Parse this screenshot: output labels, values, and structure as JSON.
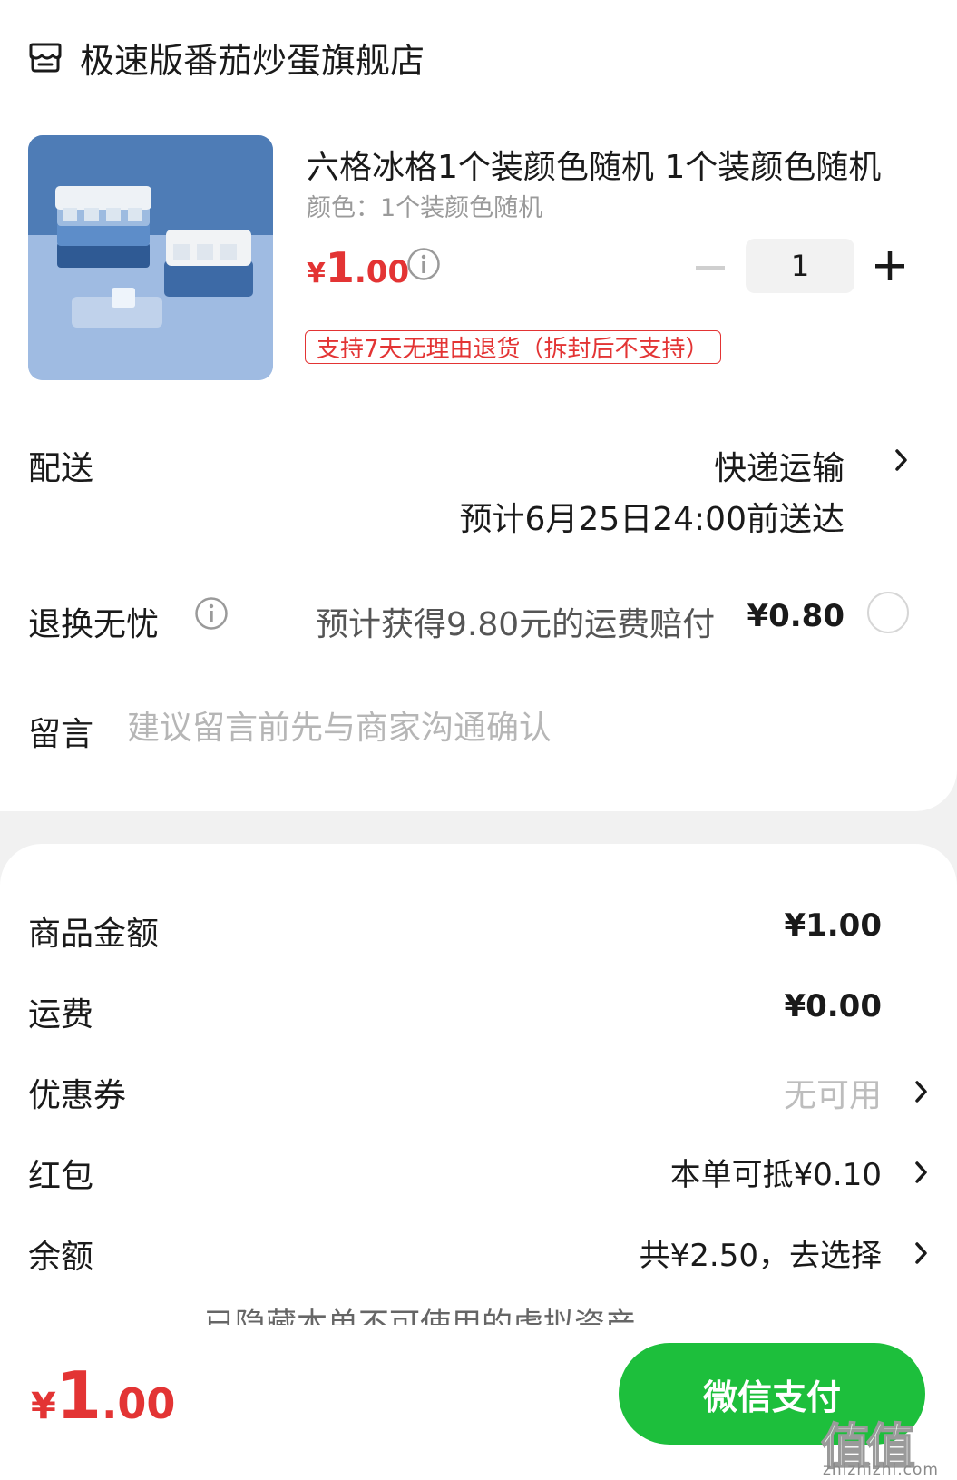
{
  "store": {
    "name": "极速版番茄炒蛋旗舰店",
    "icon": "store-icon"
  },
  "product": {
    "title": "六格冰格1个装颜色随机 1个装颜色随机",
    "variant": "颜色：1个装颜色随机",
    "price_symbol": "¥",
    "price_int": "1",
    "price_dec": ".00",
    "quantity": "1",
    "return_policy": "支持7天无理由退货（拆封后不支持）"
  },
  "delivery": {
    "label": "配送",
    "method": "快递运输",
    "eta": "预计6月25日24:00前送达"
  },
  "worry_free": {
    "label": "退换无忧",
    "text": "预计获得9.80元的运费赔付",
    "price": "¥0.80"
  },
  "note": {
    "label": "留言",
    "placeholder": "建议留言前先与商家沟通确认"
  },
  "summary": {
    "goods_label": "商品金额",
    "goods_value": "¥1.00",
    "shipping_label": "运费",
    "shipping_value": "¥0.00",
    "coupon_label": "优惠券",
    "coupon_value": "无可用",
    "redpacket_label": "红包",
    "redpacket_value": "本单可抵¥0.10",
    "balance_label": "余额",
    "balance_value": "共¥2.50，去选择",
    "hidden_notice": "已隐藏本单不可使用的虚拟资产"
  },
  "footer": {
    "total_symbol": "¥",
    "total_int": "1",
    "total_dec": ".00",
    "pay_label": "微信支付"
  },
  "watermark": {
    "glyph": "值值值",
    "domain": "zhizhizhi.com"
  },
  "colors": {
    "accent_red": "#e33434",
    "pay_green": "#1dbf3c"
  }
}
